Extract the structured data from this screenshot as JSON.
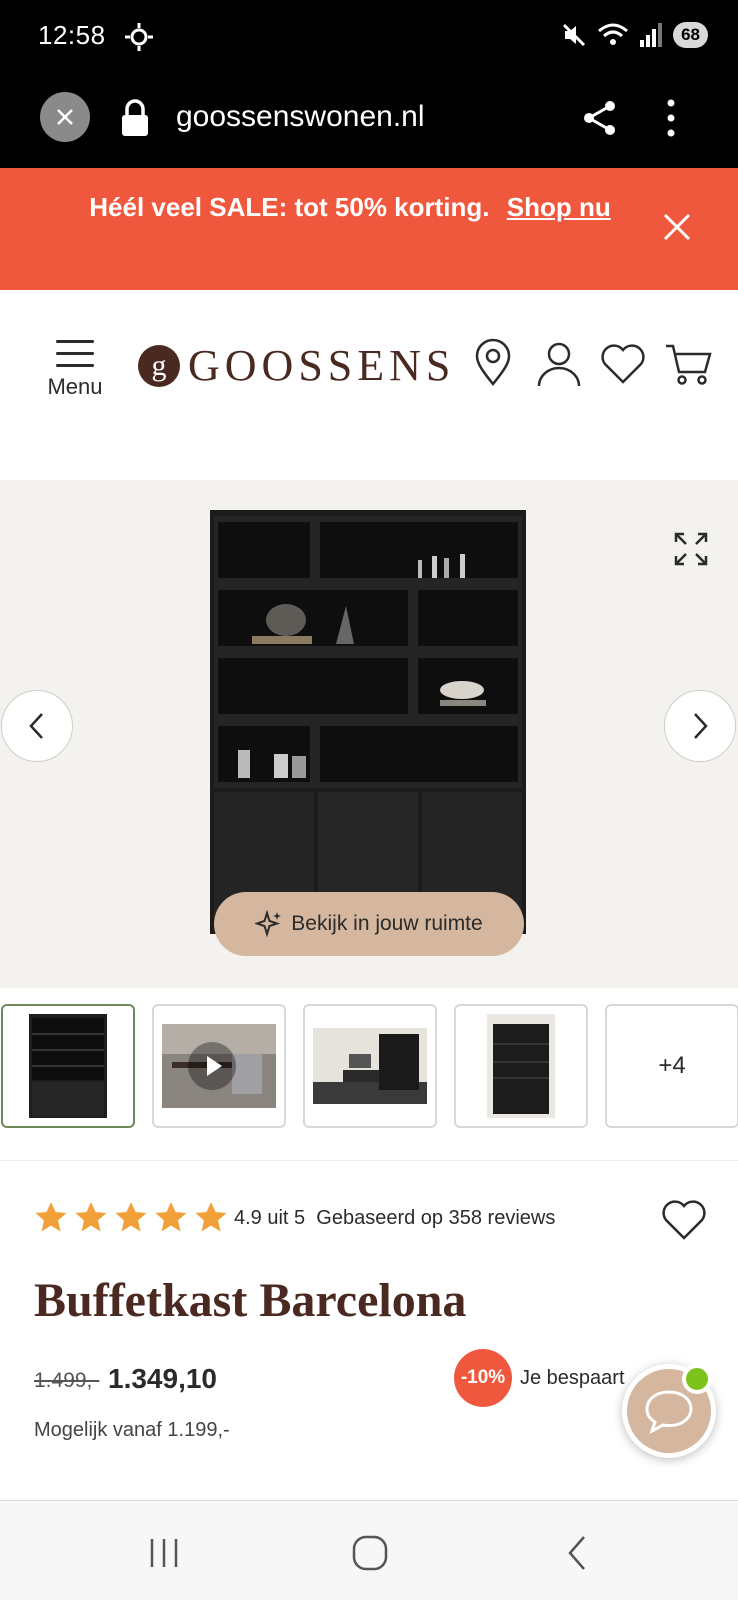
{
  "status_bar": {
    "time": "12:58",
    "battery": "68"
  },
  "browser": {
    "url": "goossenswonen.nl"
  },
  "sale_banner": {
    "text": "Héél veel SALE: tot 50% korting.",
    "link": "Shop nu"
  },
  "header": {
    "menu_label": "Menu",
    "logo_mark": "g",
    "logo_text": "GOOSSENS"
  },
  "gallery": {
    "ar_button": "Bekijk in jouw ruimte",
    "more_count": "+4"
  },
  "product": {
    "rating_value": 4.9,
    "rating_text": "4.9 uit 5",
    "reviews_text": "Gebaseerd op 358 reviews",
    "title": "Buffetkast Barcelona",
    "old_price": "1.499,-",
    "new_price": "1.349,10",
    "discount": "-10%",
    "save_text": "Je bespaart",
    "finance_text": "Mogelijk vanaf 1.199,-"
  },
  "colors": {
    "sale": "#f0583e",
    "brand": "#4a2a20",
    "star": "#f2a13a",
    "ar_button": "#d4b79e",
    "chat_online": "#7ec21c"
  }
}
